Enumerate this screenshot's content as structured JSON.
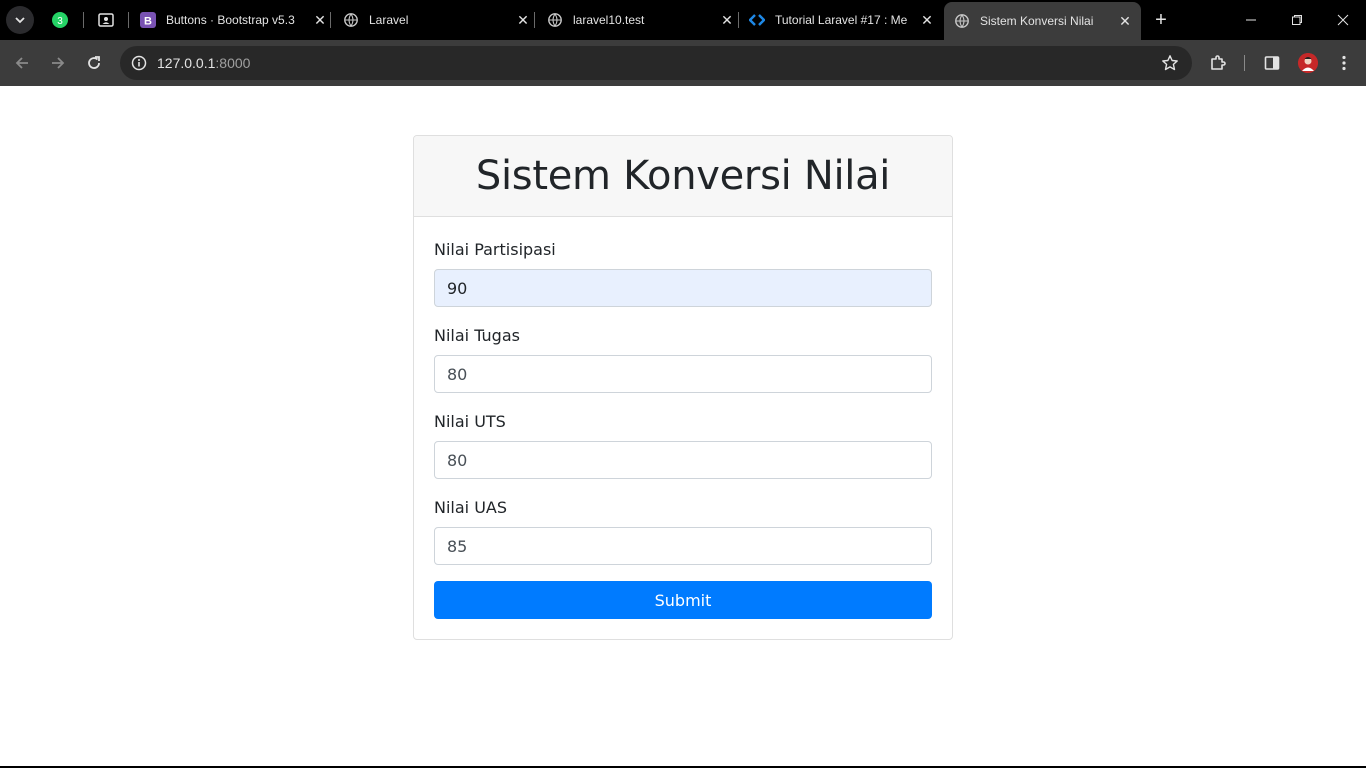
{
  "browser": {
    "pinned_tabs": [
      {
        "name": "whatsapp",
        "badge": "3"
      },
      {
        "name": "contacts"
      }
    ],
    "tabs": [
      {
        "title": "Buttons · Bootstrap v5.3",
        "favicon_letter": "B"
      },
      {
        "title": "Laravel"
      },
      {
        "title": "laravel10.test"
      },
      {
        "title": "Tutorial Laravel #17 : Me"
      },
      {
        "title": "Sistem Konversi Nilai",
        "active": true
      }
    ],
    "address": {
      "host": "127.0.0.1",
      "port": ":8000"
    },
    "colors": {
      "accent_bootstrap": "#7952b3",
      "whatsapp": "#25d366",
      "primary": "#007bff"
    }
  },
  "page": {
    "title": "Sistem Konversi Nilai",
    "fields": [
      {
        "label": "Nilai Partisipasi",
        "value": "90"
      },
      {
        "label": "Nilai Tugas",
        "value": "80"
      },
      {
        "label": "Nilai UTS",
        "value": "80"
      },
      {
        "label": "Nilai UAS",
        "value": "85"
      }
    ],
    "submit_label": "Submit"
  }
}
